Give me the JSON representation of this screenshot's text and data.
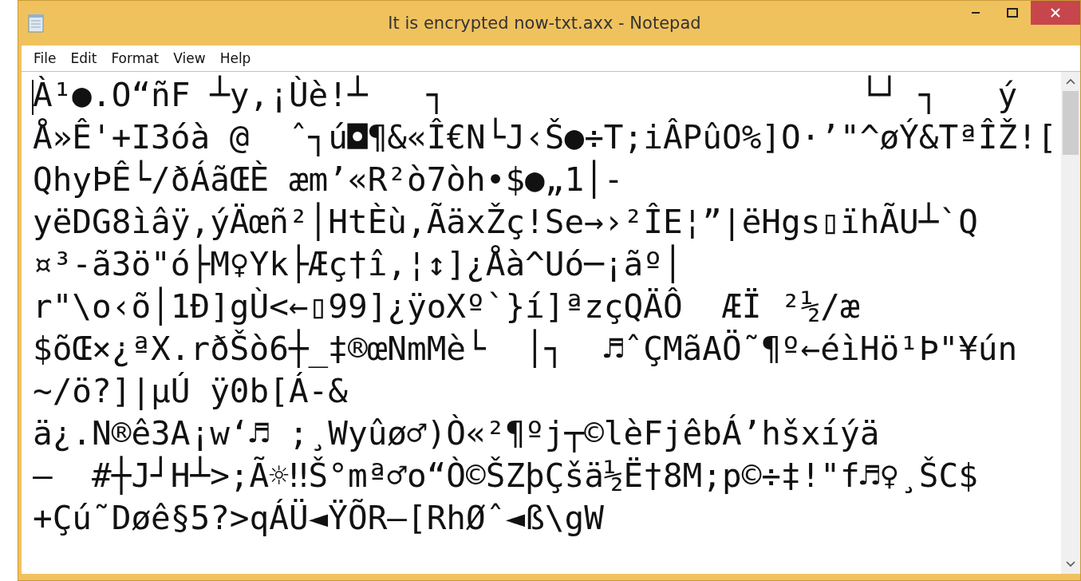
{
  "window": {
    "title": "It is encrypted now-txt.axx - Notepad"
  },
  "menu": [
    {
      "label": "File"
    },
    {
      "label": "Edit"
    },
    {
      "label": "Format"
    },
    {
      "label": "View"
    },
    {
      "label": "Help"
    }
  ],
  "document": {
    "lines": [
      "À¹●.O“ñF ┴y,¡Ùè!┴   ┐                     └┘ ┐   ý",
      "Å»Ê'+I3óà @  ˆ┐ú◘¶&«Î€N└J‹Š●÷T;iÂPûO%]O·’\"^øÝ&TªÎŽ![",
      "QhyÞÊ└/ðÁãŒÈ æm’«R²ò7òh•$●„1│-",
      "yëDG8ìâÿ,ýÄœñ²│HtÈù,ÃäxŽç!Se→›²ÎE¦”|ëHgs▯ïhÃU┴`Q",
      "¤³-ã3ö\"ó├M♀Yk├Æç†î,¦↕]¿Åà^Uó─¡ãº│",
      "r\"\\o‹õ│1Ð]gÙ<←▯99]¿ÿoXº`}í]ªzçQÄÔ  ÆÏ ²½/æ",
      "$õŒ×¿ªX.rðŠò6┼_‡®œNmMè└  │┐  ♬ˆÇMãAÖ˜¶º←éìHö¹Þ\"¥ún",
      "~/ö?]|µÚ ÿ0b[Á-&",
      "ä¿.N®ê3A¡w‘♬ ;¸Wyûø♂)Ò«²¶ºj┬©lèFjêbÁ’hšxíýä",
      "—  #┼J┘H┴>;Ã☼‼Š°mª♂o“Ò©ŠZþÇšä½Ë†8M;p©÷‡!\"f♬♀¸ŠC$",
      "+Çú˜Døê§5?>qÁÜ◄ŸÕR–[RhØˆ◄ß\\gW"
    ]
  }
}
